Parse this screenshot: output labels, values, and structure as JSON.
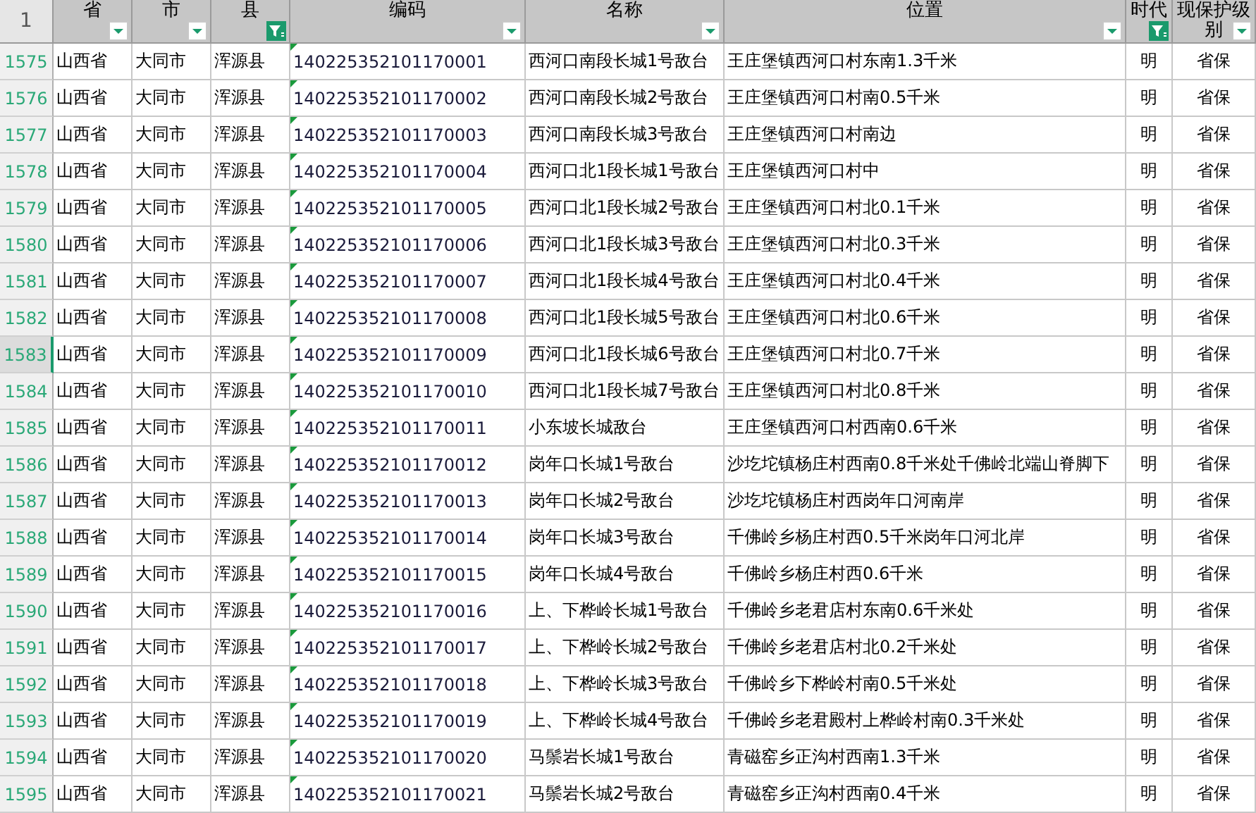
{
  "corner": "1",
  "columns": [
    {
      "label": "省",
      "filter_active": false
    },
    {
      "label": "市",
      "filter_active": false
    },
    {
      "label": "县",
      "filter_active": true
    },
    {
      "label": "编码",
      "filter_active": false
    },
    {
      "label": "名称",
      "filter_active": false
    },
    {
      "label": "位置",
      "filter_active": false
    },
    {
      "label": "时代",
      "filter_active": true
    },
    {
      "label": "现保护级别",
      "filter_active": false
    }
  ],
  "rows": [
    {
      "num": "1575",
      "selected": false,
      "cells": [
        "山西省",
        "大同市",
        "浑源县",
        "140225352101170001",
        "西河口南段长城1号敌台",
        "王庄堡镇西河口村东南1.3千米",
        "明",
        "省保"
      ]
    },
    {
      "num": "1576",
      "selected": false,
      "cells": [
        "山西省",
        "大同市",
        "浑源县",
        "140225352101170002",
        "西河口南段长城2号敌台",
        "王庄堡镇西河口村南0.5千米",
        "明",
        "省保"
      ]
    },
    {
      "num": "1577",
      "selected": false,
      "cells": [
        "山西省",
        "大同市",
        "浑源县",
        "140225352101170003",
        "西河口南段长城3号敌台",
        "王庄堡镇西河口村南边",
        "明",
        "省保"
      ]
    },
    {
      "num": "1578",
      "selected": false,
      "cells": [
        "山西省",
        "大同市",
        "浑源县",
        "140225352101170004",
        "西河口北1段长城1号敌台",
        "王庄堡镇西河口村中",
        "明",
        "省保"
      ]
    },
    {
      "num": "1579",
      "selected": false,
      "cells": [
        "山西省",
        "大同市",
        "浑源县",
        "140225352101170005",
        "西河口北1段长城2号敌台",
        "王庄堡镇西河口村北0.1千米",
        "明",
        "省保"
      ]
    },
    {
      "num": "1580",
      "selected": false,
      "cells": [
        "山西省",
        "大同市",
        "浑源县",
        "140225352101170006",
        "西河口北1段长城3号敌台",
        "王庄堡镇西河口村北0.3千米",
        "明",
        "省保"
      ]
    },
    {
      "num": "1581",
      "selected": false,
      "cells": [
        "山西省",
        "大同市",
        "浑源县",
        "140225352101170007",
        "西河口北1段长城4号敌台",
        "王庄堡镇西河口村北0.4千米",
        "明",
        "省保"
      ]
    },
    {
      "num": "1582",
      "selected": false,
      "cells": [
        "山西省",
        "大同市",
        "浑源县",
        "140225352101170008",
        "西河口北1段长城5号敌台",
        "王庄堡镇西河口村北0.6千米",
        "明",
        "省保"
      ]
    },
    {
      "num": "1583",
      "selected": true,
      "cells": [
        "山西省",
        "大同市",
        "浑源县",
        "140225352101170009",
        "西河口北1段长城6号敌台",
        "王庄堡镇西河口村北0.7千米",
        "明",
        "省保"
      ]
    },
    {
      "num": "1584",
      "selected": false,
      "cells": [
        "山西省",
        "大同市",
        "浑源县",
        "140225352101170010",
        "西河口北1段长城7号敌台",
        "王庄堡镇西河口村北0.8千米",
        "明",
        "省保"
      ]
    },
    {
      "num": "1585",
      "selected": false,
      "cells": [
        "山西省",
        "大同市",
        "浑源县",
        "140225352101170011",
        "小东坡长城敌台",
        "王庄堡镇西河口村西南0.6千米",
        "明",
        "省保"
      ]
    },
    {
      "num": "1586",
      "selected": false,
      "cells": [
        "山西省",
        "大同市",
        "浑源县",
        "140225352101170012",
        "岗年口长城1号敌台",
        "沙圪坨镇杨庄村西南0.8千米处千佛岭北端山脊脚下",
        "明",
        "省保"
      ]
    },
    {
      "num": "1587",
      "selected": false,
      "cells": [
        "山西省",
        "大同市",
        "浑源县",
        "140225352101170013",
        "岗年口长城2号敌台",
        "沙圪坨镇杨庄村西岗年口河南岸",
        "明",
        "省保"
      ]
    },
    {
      "num": "1588",
      "selected": false,
      "cells": [
        "山西省",
        "大同市",
        "浑源县",
        "140225352101170014",
        "岗年口长城3号敌台",
        "千佛岭乡杨庄村西0.5千米岗年口河北岸",
        "明",
        "省保"
      ]
    },
    {
      "num": "1589",
      "selected": false,
      "cells": [
        "山西省",
        "大同市",
        "浑源县",
        "140225352101170015",
        "岗年口长城4号敌台",
        "千佛岭乡杨庄村西0.6千米",
        "明",
        "省保"
      ]
    },
    {
      "num": "1590",
      "selected": false,
      "cells": [
        "山西省",
        "大同市",
        "浑源县",
        "140225352101170016",
        "上、下桦岭长城1号敌台",
        "千佛岭乡老君店村东南0.6千米处",
        "明",
        "省保"
      ]
    },
    {
      "num": "1591",
      "selected": false,
      "cells": [
        "山西省",
        "大同市",
        "浑源县",
        "140225352101170017",
        "上、下桦岭长城2号敌台",
        "千佛岭乡老君店村北0.2千米处",
        "明",
        "省保"
      ]
    },
    {
      "num": "1592",
      "selected": false,
      "cells": [
        "山西省",
        "大同市",
        "浑源县",
        "140225352101170018",
        "上、下桦岭长城3号敌台",
        "千佛岭乡下桦岭村南0.5千米处",
        "明",
        "省保"
      ]
    },
    {
      "num": "1593",
      "selected": false,
      "cells": [
        "山西省",
        "大同市",
        "浑源县",
        "140225352101170019",
        "上、下桦岭长城4号敌台",
        "千佛岭乡老君殿村上桦岭村南0.3千米处",
        "明",
        "省保"
      ]
    },
    {
      "num": "1594",
      "selected": false,
      "cells": [
        "山西省",
        "大同市",
        "浑源县",
        "140225352101170020",
        "马鬃岩长城1号敌台",
        "青磁窑乡正沟村西南1.3千米",
        "明",
        "省保"
      ]
    },
    {
      "num": "1595",
      "selected": false,
      "cells": [
        "山西省",
        "大同市",
        "浑源县",
        "140225352101170021",
        "马鬃岩长城2号敌台",
        "青磁窑乡正沟村西南0.4千米",
        "明",
        "省保"
      ]
    }
  ]
}
